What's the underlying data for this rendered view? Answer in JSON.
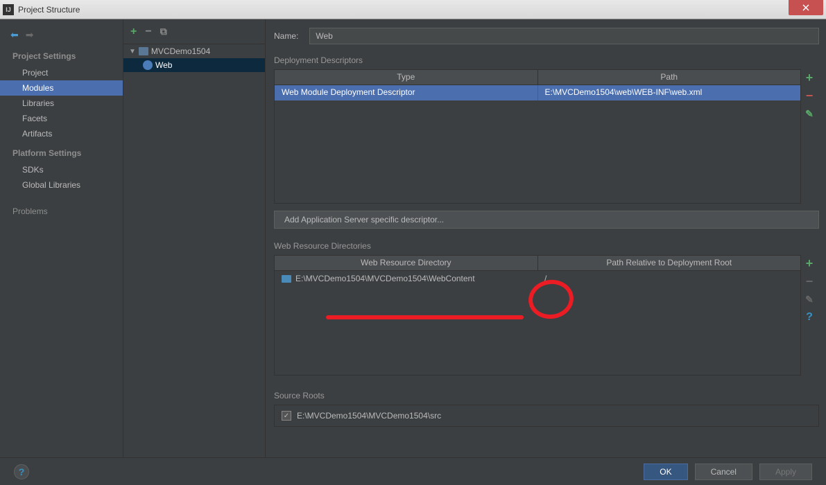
{
  "window": {
    "title": "Project Structure"
  },
  "leftNav": {
    "projectSettings": "Project Settings",
    "items": {
      "project": "Project",
      "modules": "Modules",
      "libraries": "Libraries",
      "facets": "Facets",
      "artifacts": "Artifacts"
    },
    "platformSettings": "Platform Settings",
    "platformItems": {
      "sdks": "SDKs",
      "globalLibraries": "Global Libraries"
    },
    "problems": "Problems"
  },
  "tree": {
    "root": "MVCDemo1504",
    "child": "Web"
  },
  "form": {
    "nameLabel": "Name:",
    "nameValue": "Web"
  },
  "deployment": {
    "title": "Deployment Descriptors",
    "headers": {
      "type": "Type",
      "path": "Path"
    },
    "row": {
      "type": "Web Module Deployment Descriptor",
      "path": "E:\\MVCDemo1504\\web\\WEB-INF\\web.xml"
    },
    "addServerBtn": "Add Application Server specific descriptor..."
  },
  "webResources": {
    "title": "Web Resource Directories",
    "headers": {
      "dir": "Web Resource Directory",
      "relPath": "Path Relative to Deployment Root"
    },
    "row": {
      "dir": "E:\\MVCDemo1504\\MVCDemo1504\\WebContent",
      "relPath": "/"
    }
  },
  "sourceRoots": {
    "title": "Source Roots",
    "item": "E:\\MVCDemo1504\\MVCDemo1504\\src"
  },
  "buttons": {
    "ok": "OK",
    "cancel": "Cancel",
    "apply": "Apply"
  }
}
